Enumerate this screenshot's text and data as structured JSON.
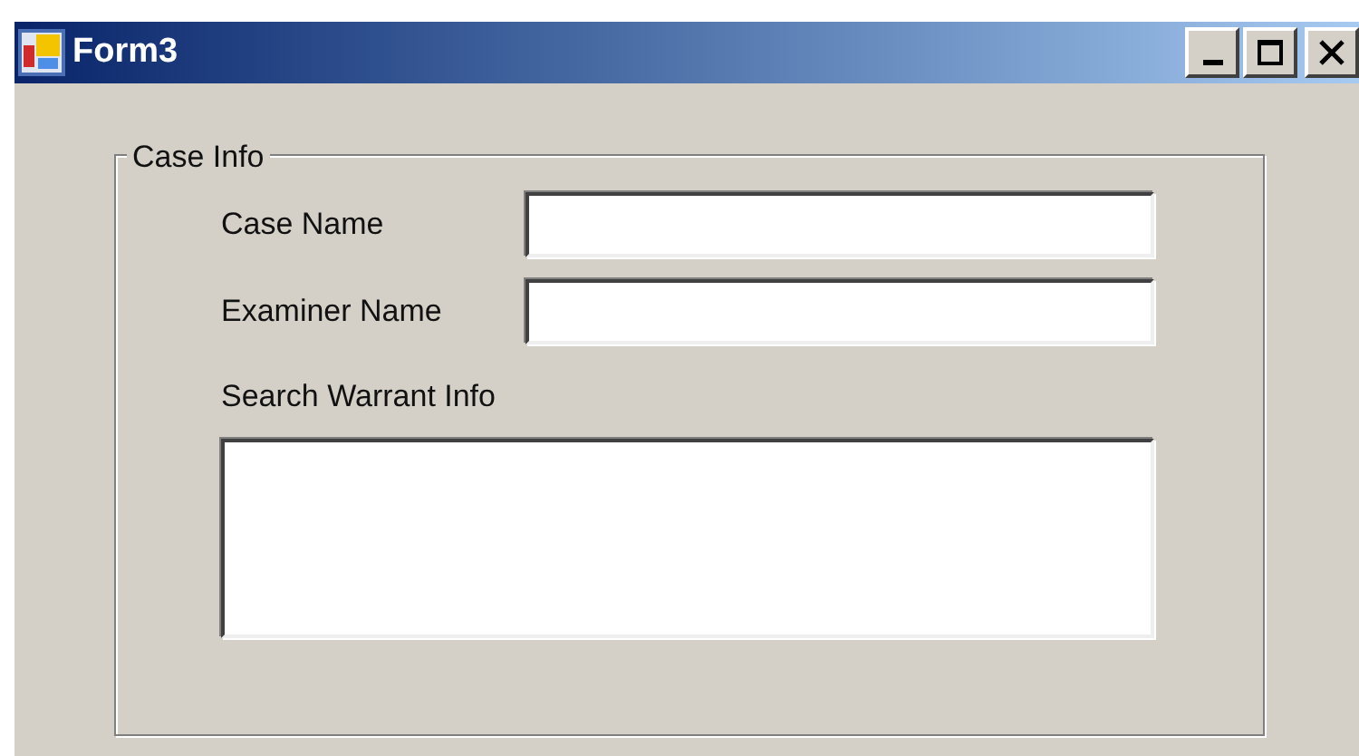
{
  "window": {
    "title": "Form3"
  },
  "group": {
    "title": "Case Info",
    "fields": [
      {
        "kind": "line",
        "label": "Case Name"
      },
      {
        "kind": "line",
        "label": "Examiner Name"
      },
      {
        "kind": "multiline",
        "label": "Search Warrant Info"
      }
    ]
  }
}
